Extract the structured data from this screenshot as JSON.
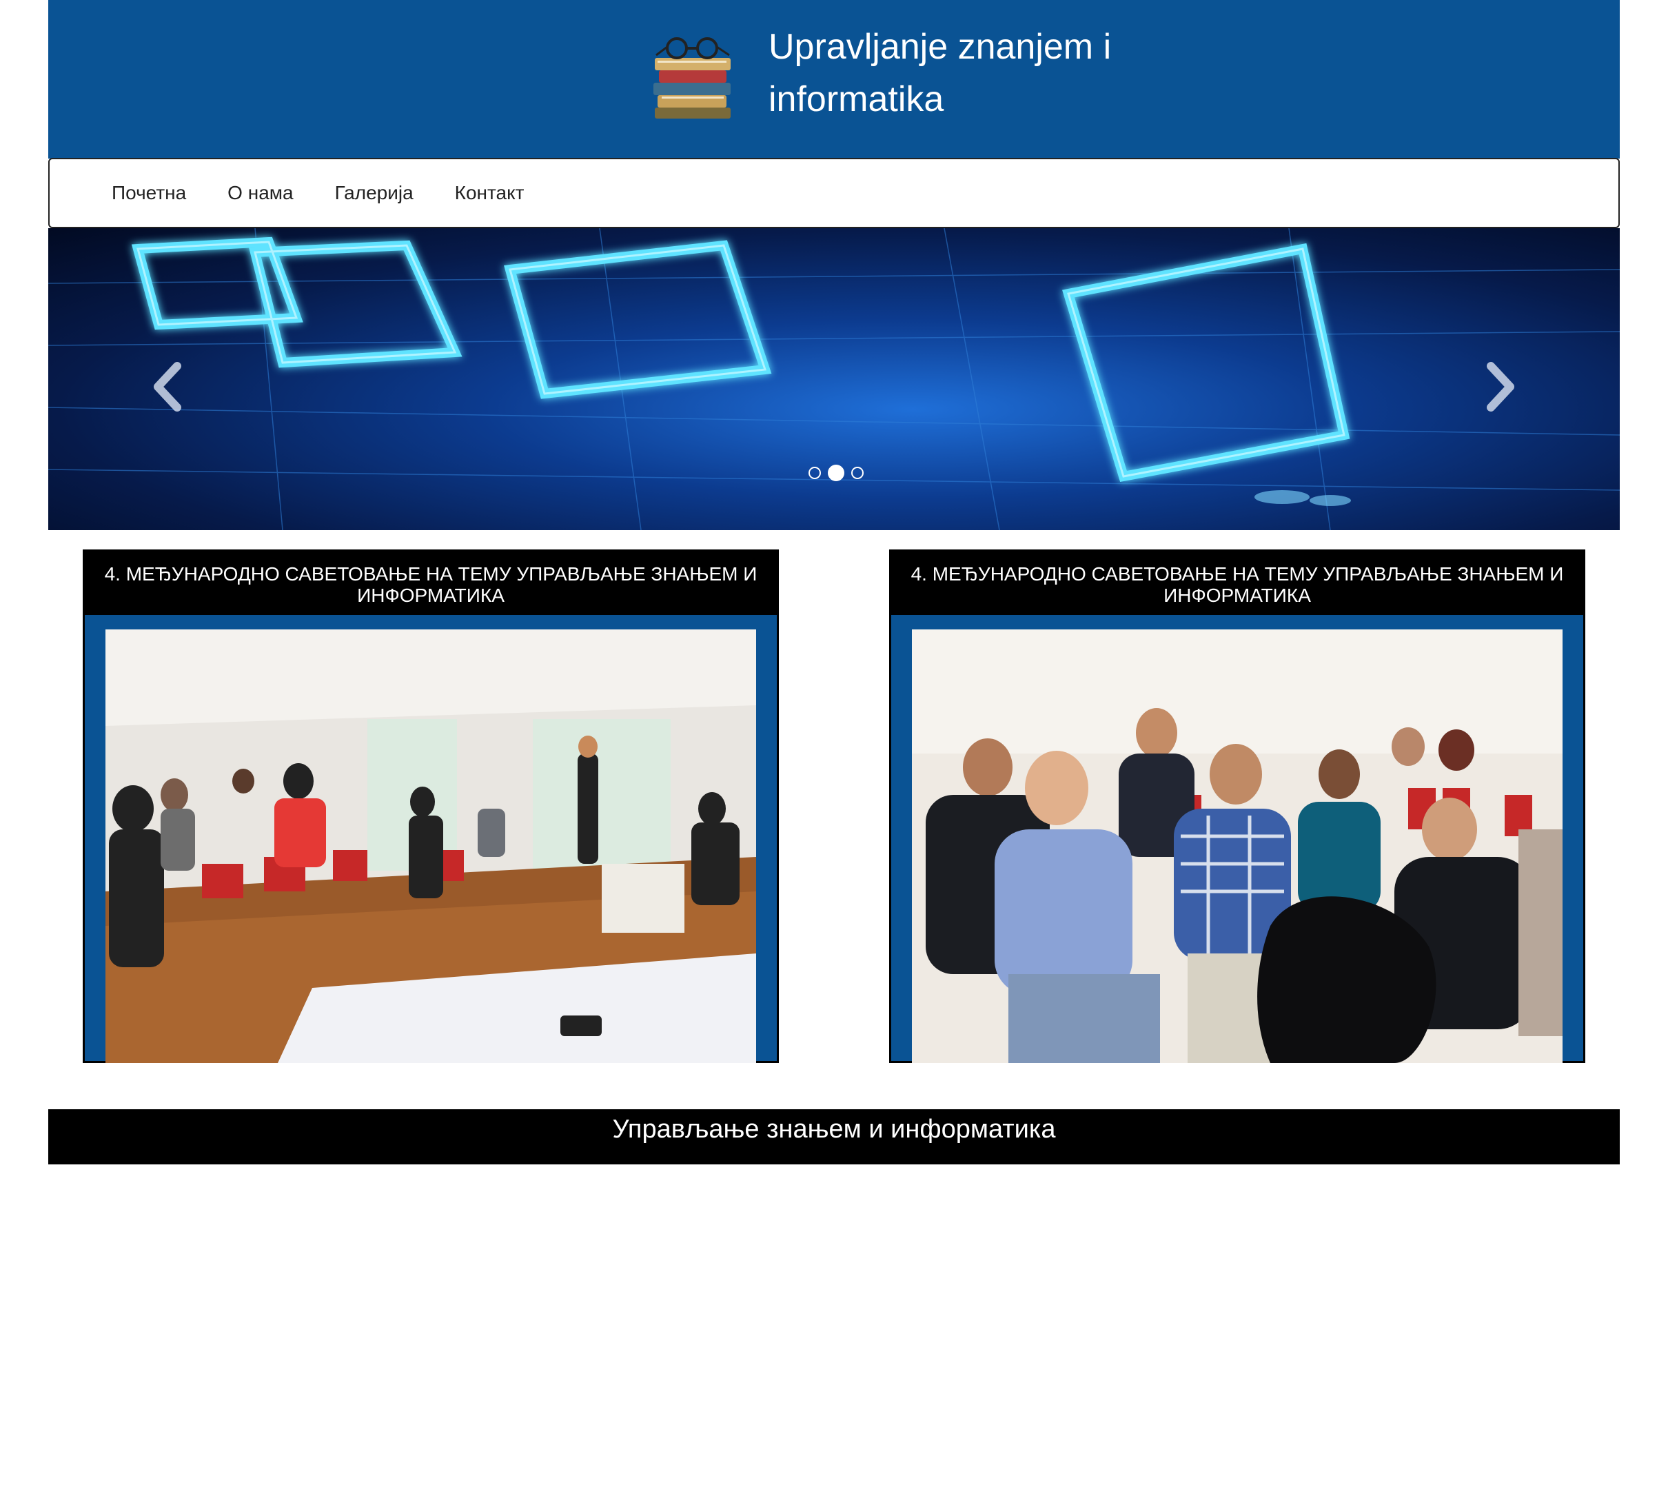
{
  "header": {
    "title_line1": "Upravljanje znanjem i",
    "title_line2": "informatika",
    "logo_icon": "books-with-glasses-icon"
  },
  "nav": {
    "items": [
      {
        "label": "Почетна"
      },
      {
        "label": "О нама"
      },
      {
        "label": "Галерија"
      },
      {
        "label": "Контакт"
      }
    ]
  },
  "carousel": {
    "prev_icon": "chevron-left-icon",
    "next_icon": "chevron-right-icon",
    "slide_count": 3,
    "active_index": 1
  },
  "cards": [
    {
      "title": "4. МЕЂУНАРОДНО САВЕТОВАЊЕ НА ТЕМУ УПРАВЉАЊЕ ЗНАЊЕМ И ИНФОРМАТИКА"
    },
    {
      "title": "4. МЕЂУНАРОДНО САВЕТОВАЊЕ НА ТЕМУ УПРАВЉАЊЕ ЗНАЊЕМ И ИНФОРМАТИКА"
    }
  ],
  "footer": {
    "text": "Управљање знањем и информатика"
  },
  "colors": {
    "brand_blue": "#0a5394",
    "black": "#000000",
    "white": "#ffffff"
  }
}
